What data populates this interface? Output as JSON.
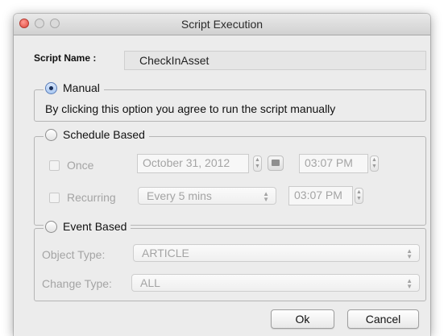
{
  "window": {
    "title": "Script Execution"
  },
  "script_name": {
    "label": "Script Name :",
    "value": "CheckInAsset"
  },
  "manual": {
    "label": "Manual",
    "selected": true,
    "description": "By clicking this option you agree to run the script manually"
  },
  "schedule": {
    "label": "Schedule Based",
    "selected": false,
    "once": {
      "label": "Once",
      "checked": false,
      "date": "October 31, 2012",
      "time": "03:07 PM"
    },
    "recurring": {
      "label": "Recurring",
      "checked": false,
      "interval": "Every 5 mins",
      "time": "03:07 PM"
    }
  },
  "event": {
    "label": "Event Based",
    "selected": false,
    "object_type": {
      "label": "Object Type:",
      "value": "ARTICLE"
    },
    "change_type": {
      "label": "Change Type:",
      "value": "ALL"
    }
  },
  "buttons": {
    "ok": "Ok",
    "cancel": "Cancel"
  }
}
